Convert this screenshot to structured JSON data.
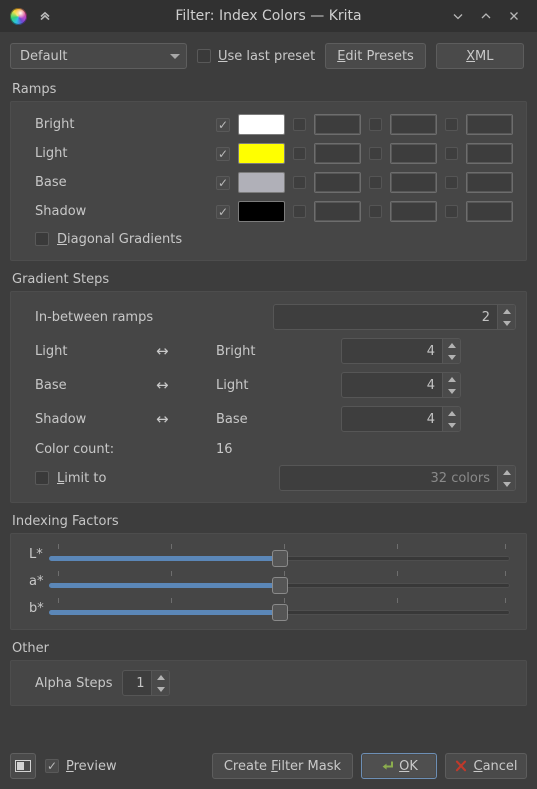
{
  "titlebar": {
    "title": "Filter: Index Colors — Krita",
    "logo_icon": "krita-logo-icon",
    "collapse_icon": "double-chevron-up-icon",
    "minimize_icon": "chevron-down-icon",
    "maximize_icon": "chevron-up-icon",
    "close_icon": "close-icon"
  },
  "preset_row": {
    "combo_value": "Default",
    "combo_arrow_icon": "chevron-down-icon",
    "use_last_preset": {
      "label": "Use last preset",
      "mnemonic": "U",
      "checked": false
    },
    "edit_presets": {
      "label": "Edit Presets",
      "mnemonic": "E"
    },
    "xml": {
      "label": "XML",
      "mnemonic": "X"
    }
  },
  "ramps": {
    "title": "Ramps",
    "rows": [
      {
        "name": "Bright",
        "enabled": true,
        "color": "#ffffff"
      },
      {
        "name": "Light",
        "enabled": true,
        "color": "#ffff00"
      },
      {
        "name": "Base",
        "enabled": true,
        "color": "#b0b0b8"
      },
      {
        "name": "Shadow",
        "enabled": true,
        "color": "#000000"
      }
    ],
    "extra_slots_per_row": 3,
    "diagonal_gradients": {
      "label": "Diagonal Gradients",
      "mnemonic": "D",
      "checked": false
    }
  },
  "gradient_steps": {
    "title": "Gradient Steps",
    "in_between": {
      "label": "In-between ramps",
      "value": "2"
    },
    "pairs": [
      {
        "left": "Light",
        "arrow": "↔",
        "right": "Bright",
        "value": "4"
      },
      {
        "left": "Base",
        "arrow": "↔",
        "right": "Light",
        "value": "4"
      },
      {
        "left": "Shadow",
        "arrow": "↔",
        "right": "Base",
        "value": "4"
      }
    ],
    "color_count": {
      "label": "Color count:",
      "value": "16"
    },
    "limit_to": {
      "label": "Limit to",
      "mnemonic": "L",
      "checked": false,
      "value": "32 colors",
      "disabled": true
    }
  },
  "indexing_factors": {
    "title": "Indexing Factors",
    "sliders": [
      {
        "name": "L*",
        "percent": 50
      },
      {
        "name": "a*",
        "percent": 50
      },
      {
        "name": "b*",
        "percent": 50
      }
    ],
    "tick_count": 5
  },
  "other": {
    "title": "Other",
    "alpha_steps": {
      "label": "Alpha Steps",
      "value": "1"
    }
  },
  "footer": {
    "split_view_icon": "split-view-icon",
    "preview": {
      "label": "Preview",
      "mnemonic": "P",
      "checked": true
    },
    "create_filter_mask": {
      "label": "Create Filter Mask",
      "mnemonic": "F"
    },
    "ok": {
      "label": "OK",
      "mnemonic": "O",
      "icon": "enter-arrow-icon"
    },
    "cancel": {
      "label": "Cancel",
      "mnemonic": "C",
      "icon": "cross-icon"
    }
  },
  "colors": {
    "window_bg": "#3d3d3d",
    "titlebar_bg": "#313131",
    "group_bg": "#464646",
    "accent_blue": "#5b87b8",
    "ok_icon_green": "#8bad4e",
    "cancel_icon_red": "#c0392b"
  }
}
